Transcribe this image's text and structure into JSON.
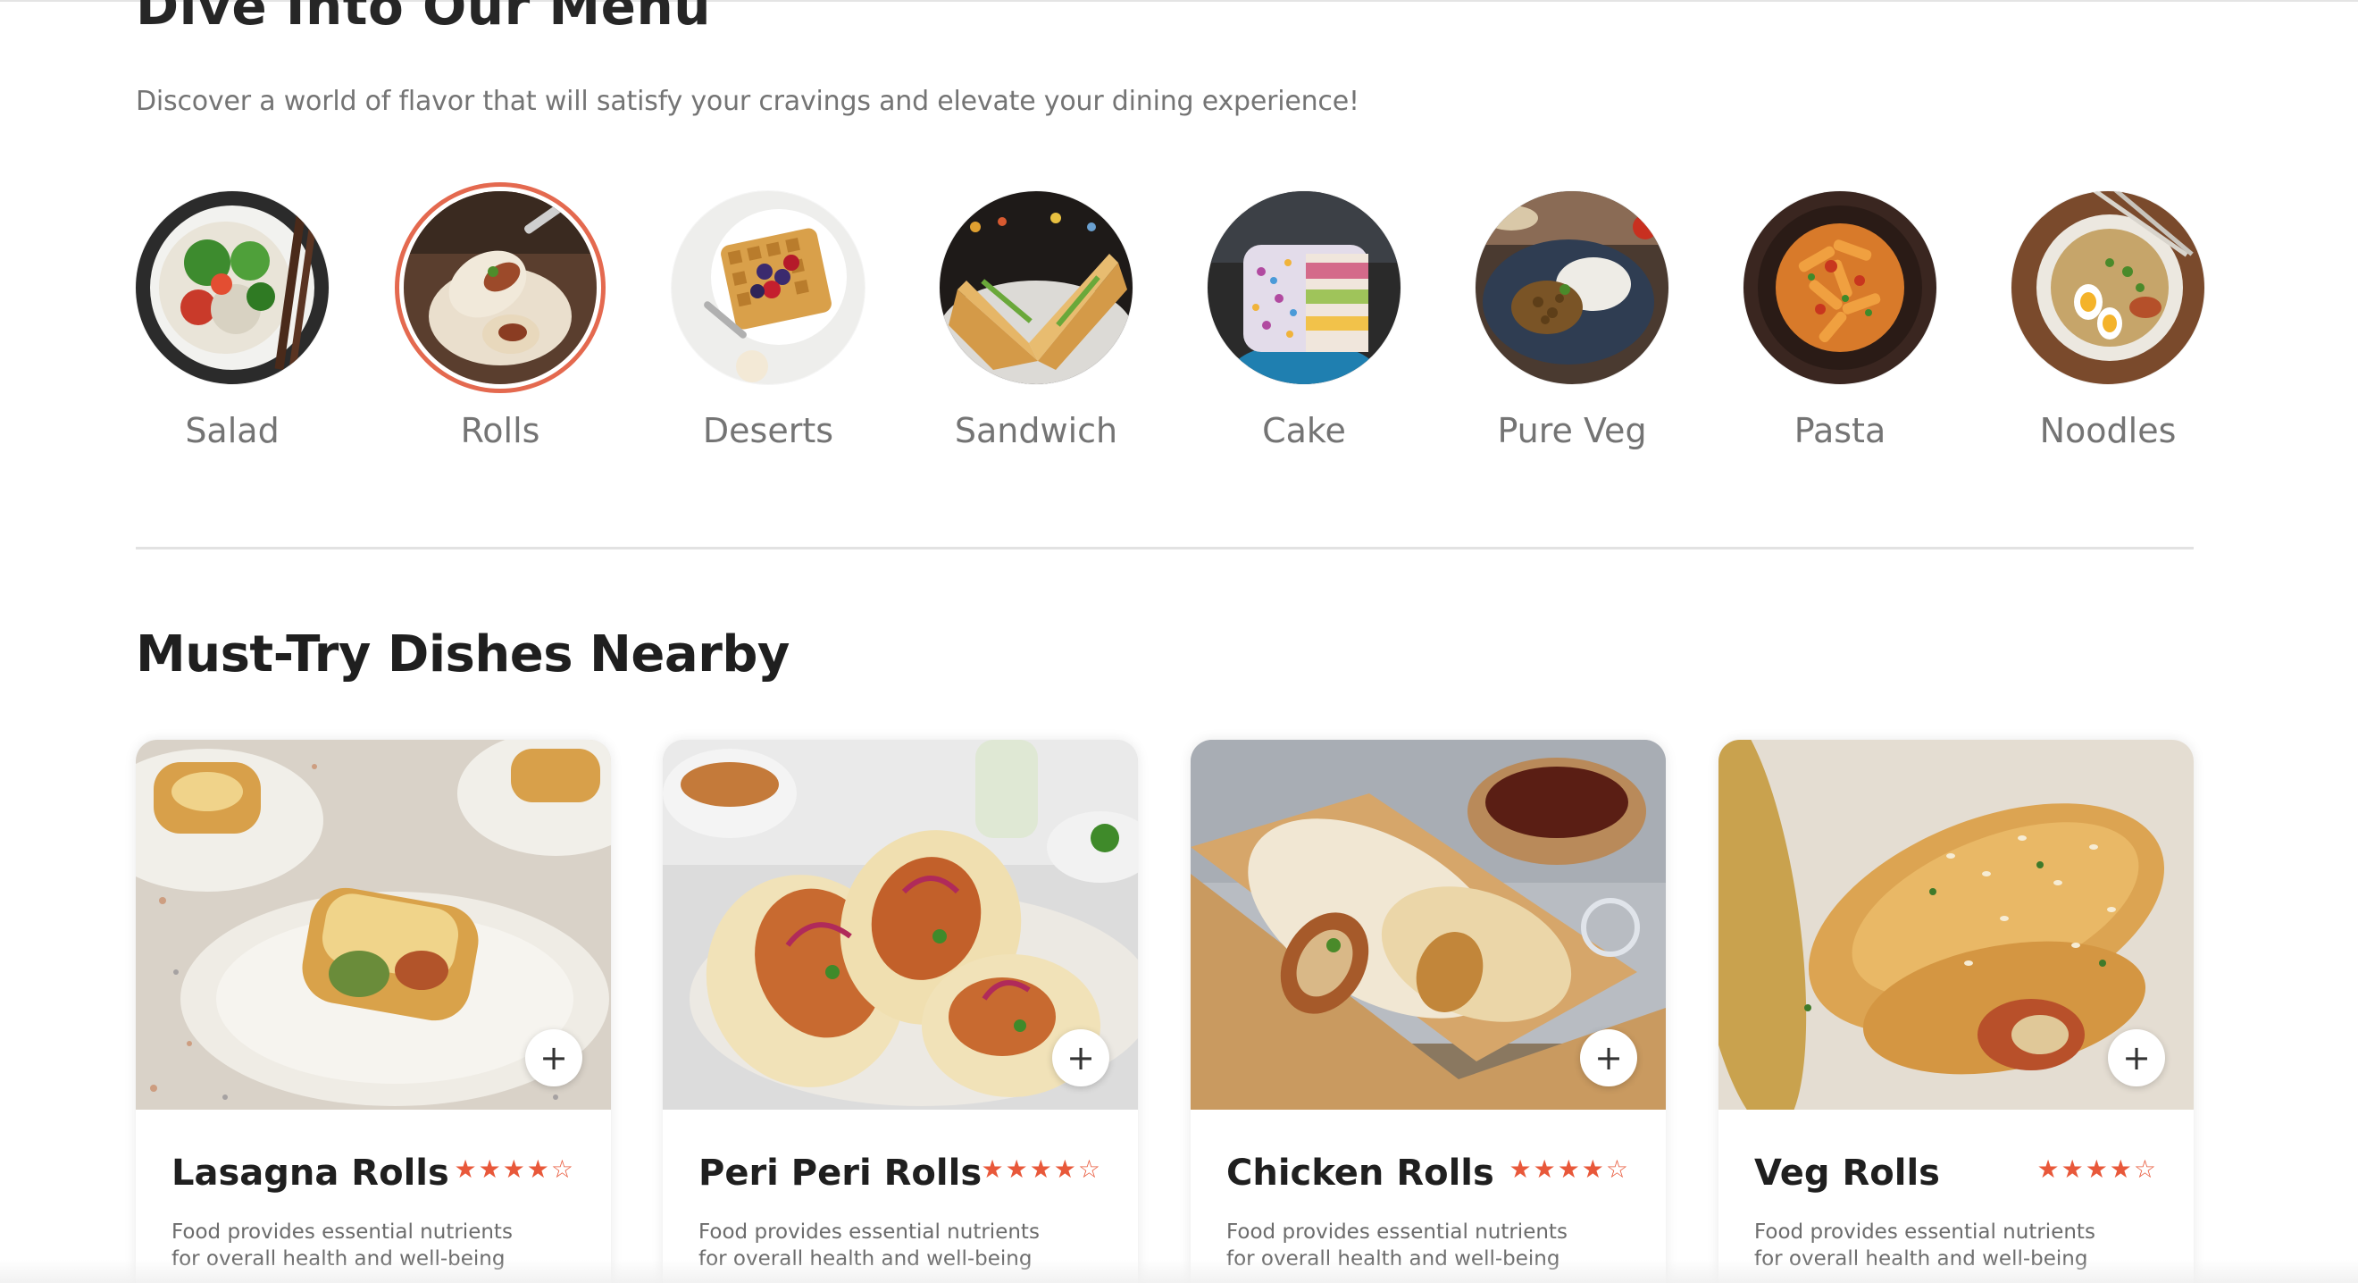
{
  "menu": {
    "title": "Dive Into Our Menu",
    "subtitle": "Discover a world of flavor that will satisfy your cravings and elevate your dining experience!",
    "categories": [
      {
        "label": "Salad",
        "icon": "salad-image",
        "active": false
      },
      {
        "label": "Rolls",
        "icon": "rolls-image",
        "active": true
      },
      {
        "label": "Deserts",
        "icon": "waffle-image",
        "active": false
      },
      {
        "label": "Sandwich",
        "icon": "sandwich-image",
        "active": false
      },
      {
        "label": "Cake",
        "icon": "cake-image",
        "active": false
      },
      {
        "label": "Pure Veg",
        "icon": "veg-plate-image",
        "active": false
      },
      {
        "label": "Pasta",
        "icon": "pasta-image",
        "active": false
      },
      {
        "label": "Noodles",
        "icon": "noodles-image",
        "active": false
      }
    ]
  },
  "dishes": {
    "title": "Must-Try Dishes Nearby",
    "items": [
      {
        "name": "Lasagna Rolls",
        "rating": 4,
        "max_rating": 5,
        "description": "Food provides essential nutrients for overall health and well-being",
        "add_label": "+"
      },
      {
        "name": "Peri Peri Rolls",
        "rating": 4,
        "max_rating": 5,
        "description": "Food provides essential nutrients for overall health and well-being",
        "add_label": "+"
      },
      {
        "name": "Chicken Rolls",
        "rating": 4,
        "max_rating": 5,
        "description": "Food provides essential nutrients for overall health and well-being",
        "add_label": "+"
      },
      {
        "name": "Veg Rolls",
        "rating": 4,
        "max_rating": 5,
        "description": "Food provides essential nutrients for overall health and well-being",
        "add_label": "+"
      }
    ]
  },
  "colors": {
    "accent": "#e4694f",
    "star": "#e8583a",
    "heading": "#1f1f1f",
    "muted": "#747474"
  }
}
